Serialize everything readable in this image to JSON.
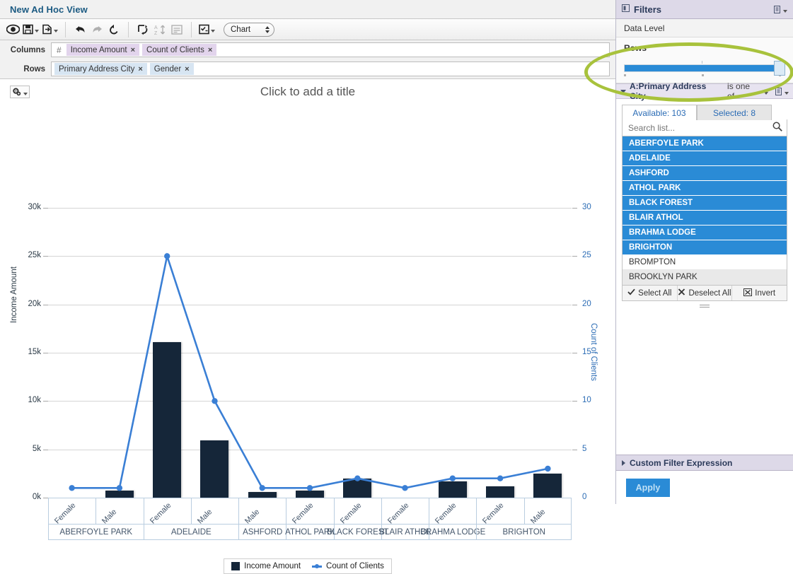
{
  "window": {
    "view_title": "New Ad Hoc View"
  },
  "toolbar": {
    "buttons": [
      {
        "name": "view-mode-icon",
        "label": ""
      },
      {
        "name": "save-icon",
        "label": ""
      },
      {
        "name": "export-icon",
        "label": ""
      },
      {
        "name": "undo-icon",
        "label": ""
      },
      {
        "name": "redo-icon",
        "label": ""
      },
      {
        "name": "revert-icon",
        "label": ""
      },
      {
        "name": "switch-group-icon",
        "label": ""
      },
      {
        "name": "sort-az-icon",
        "label": ""
      },
      {
        "name": "input-controls-icon",
        "label": ""
      },
      {
        "name": "display-options-icon",
        "label": ""
      }
    ],
    "chart_type_value": "Chart"
  },
  "shelves": {
    "columns_label": "Columns",
    "columns_hash": "#",
    "columns_fields": [
      {
        "label": "Income Amount",
        "remove": "×"
      },
      {
        "label": "Count of Clients",
        "remove": "×"
      }
    ],
    "rows_label": "Rows",
    "rows_fields": [
      {
        "label": "Primary Address City",
        "remove": "×"
      },
      {
        "label": "Gender",
        "remove": "×"
      }
    ]
  },
  "chart_title_placeholder": "Click to add a title",
  "chart_data": {
    "type": "bar",
    "title": "Click to add a title",
    "xlabel": "",
    "ylabel": "Income Amount",
    "y2label": "Count of Clients",
    "ylim": [
      0,
      30000
    ],
    "y2lim": [
      0,
      30
    ],
    "yticks": [
      "0k",
      "5k",
      "10k",
      "15k",
      "20k",
      "25k",
      "30k"
    ],
    "ytick_values": [
      0,
      5000,
      10000,
      15000,
      20000,
      25000,
      30000
    ],
    "y2ticks": [
      "0",
      "5",
      "10",
      "15",
      "20",
      "25",
      "30"
    ],
    "y2tick_values": [
      0,
      5,
      10,
      15,
      20,
      25,
      30
    ],
    "grid": true,
    "legend": {
      "position": "bottom",
      "entries": [
        "Income Amount",
        "Count of Clients"
      ]
    },
    "categories": [
      "Female",
      "Male",
      "Female",
      "Male",
      "Male",
      "Female",
      "Female",
      "Female",
      "Female",
      "Female",
      "Male"
    ],
    "groups": [
      {
        "label": "ABERFOYLE PARK",
        "span": 2
      },
      {
        "label": "ADELAIDE",
        "span": 2
      },
      {
        "label": "ASHFORD",
        "span": 1
      },
      {
        "label": "ATHOL PARK",
        "span": 1
      },
      {
        "label": "BLACK FOREST",
        "span": 1
      },
      {
        "label": "BLAIR ATHOL",
        "span": 1
      },
      {
        "label": "BRAHMA LODGE",
        "span": 1
      },
      {
        "label": "BRIGHTON",
        "span": 2
      }
    ],
    "series": [
      {
        "name": "Income Amount",
        "kind": "bar",
        "axis": "left",
        "color": "#152639",
        "values": [
          0,
          700,
          16100,
          5900,
          600,
          700,
          2000,
          0,
          1700,
          1200,
          2500
        ]
      },
      {
        "name": "Count of Clients",
        "kind": "line",
        "axis": "right",
        "color": "#3a7fd5",
        "values": [
          1,
          1,
          25,
          10,
          1,
          1,
          2,
          1,
          2,
          2,
          3
        ]
      }
    ]
  },
  "filters": {
    "panel_title": "Filters",
    "data_level_label": "Data Level",
    "rows_label": "Rows",
    "slider": {
      "value_percent": 96
    },
    "field": {
      "name": "A:Primary Address City",
      "operator": "is one of"
    },
    "tabs": [
      {
        "label": "Available: 103",
        "active": true
      },
      {
        "label": "Selected: 8",
        "active": false
      }
    ],
    "search_placeholder": "Search list...",
    "values": [
      {
        "label": "ABERFOYLE PARK",
        "state": "selected"
      },
      {
        "label": "ADELAIDE",
        "state": "selected"
      },
      {
        "label": "ASHFORD",
        "state": "selected"
      },
      {
        "label": "ATHOL PARK",
        "state": "selected"
      },
      {
        "label": "BLACK FOREST",
        "state": "selected"
      },
      {
        "label": "BLAIR ATHOL",
        "state": "selected"
      },
      {
        "label": "BRAHMA LODGE",
        "state": "selected"
      },
      {
        "label": "BRIGHTON",
        "state": "selected"
      },
      {
        "label": "BROMPTON",
        "state": "unselected"
      },
      {
        "label": "BROOKLYN PARK",
        "state": "hover"
      }
    ],
    "list_actions": [
      {
        "label": "Select All",
        "icon": "check-icon"
      },
      {
        "label": "Deselect All",
        "icon": "cross-icon"
      },
      {
        "label": "Invert",
        "icon": "invert-icon"
      }
    ],
    "custom_filter_expression_label": "Custom Filter Expression",
    "apply_label": "Apply"
  },
  "colors": {
    "accent_blue": "#2a8bd6",
    "bar_dark": "#152639",
    "line_blue": "#3a7fd5",
    "annotation_green": "#a8c23c",
    "filter_header": "#ddd9e8"
  }
}
